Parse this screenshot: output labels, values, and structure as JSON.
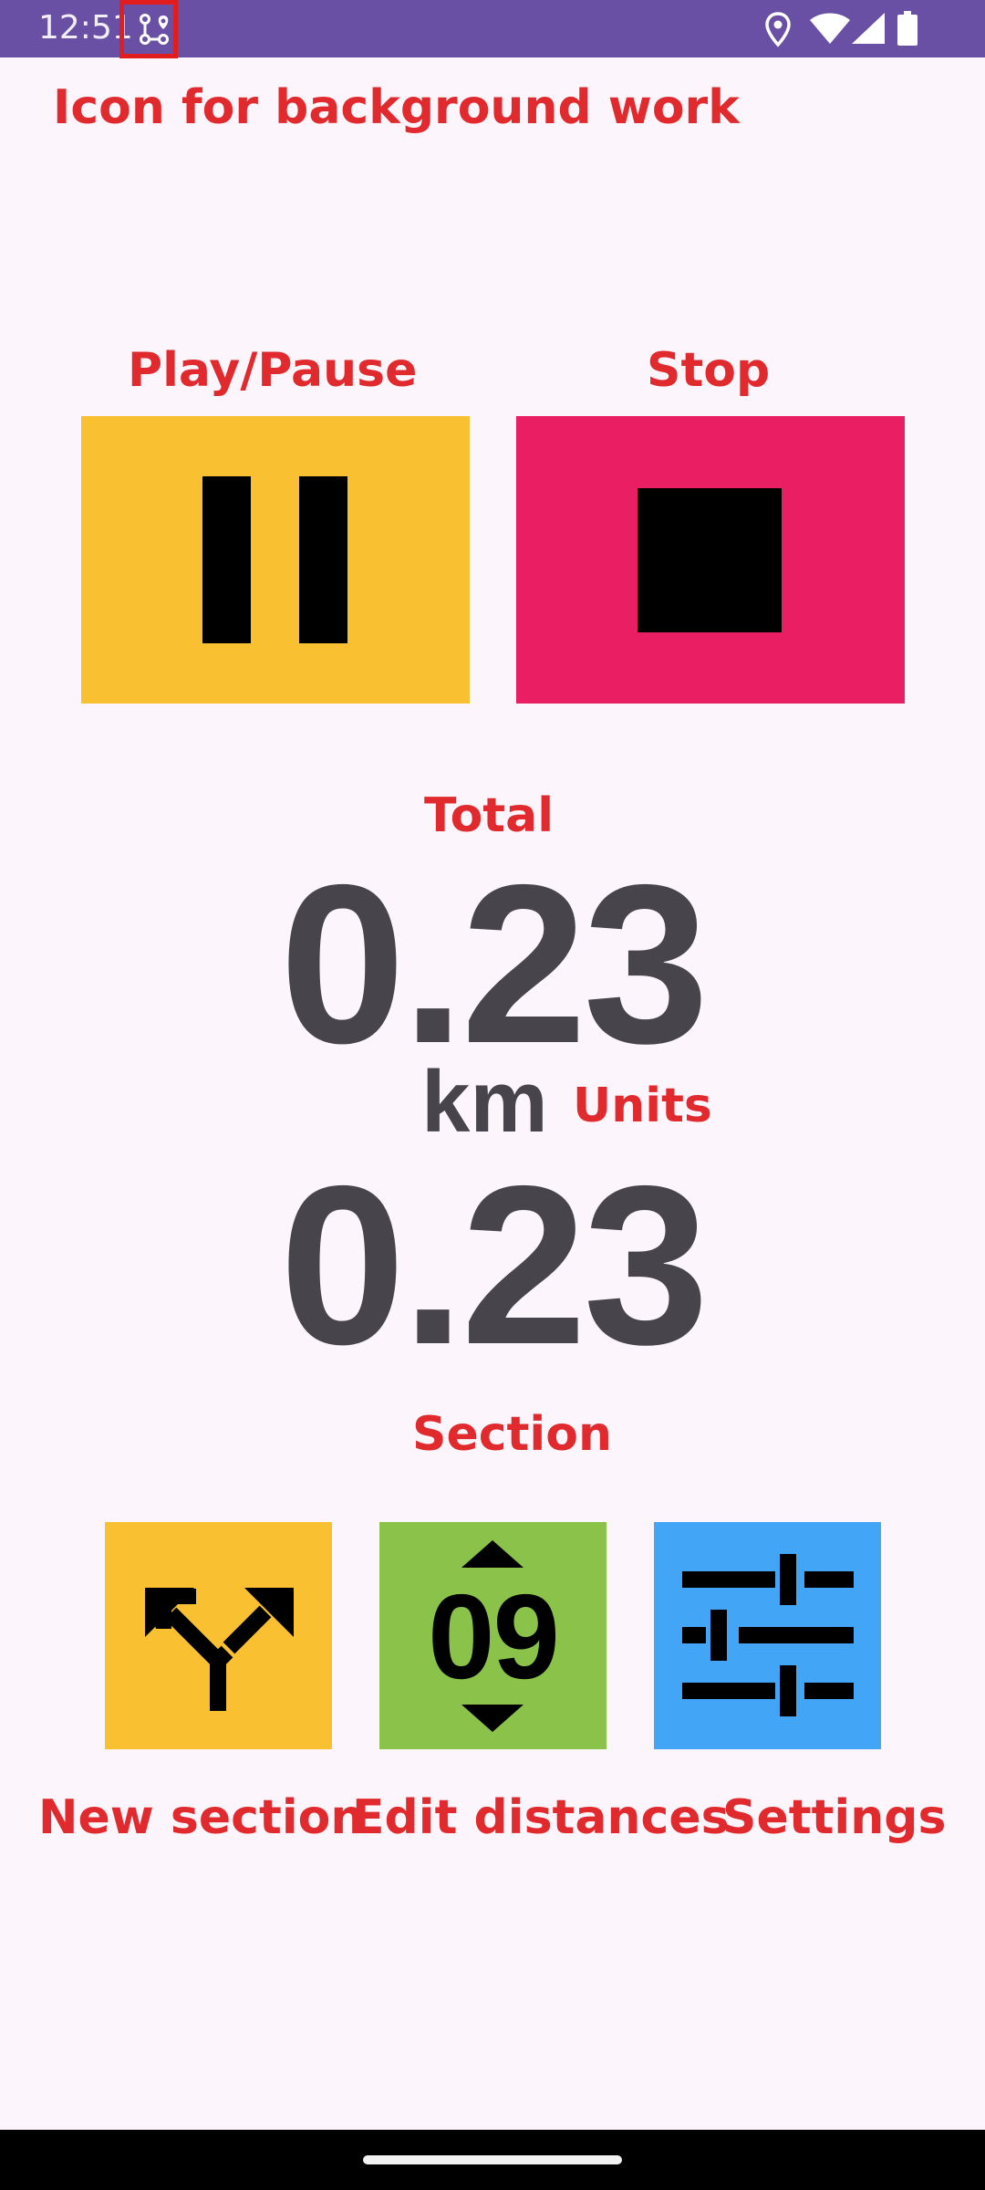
{
  "status_bar": {
    "time": "12:51",
    "background": "#6A50A4",
    "icons": [
      "background-work-icon",
      "location-icon",
      "wifi-icon",
      "signal-icon",
      "battery-icon"
    ]
  },
  "annotations": {
    "background_work": "Icon for background work",
    "play_pause": "Play/Pause",
    "stop": "Stop",
    "total": "Total",
    "units": "Units",
    "section": "Section",
    "new_section": "New section",
    "edit_distances": "Edit distances",
    "settings": "Settings",
    "color": "#E02A2E"
  },
  "controls": {
    "play_pause": {
      "icon": "pause-icon",
      "color": "#F9C032"
    },
    "stop": {
      "icon": "stop-icon",
      "color": "#E91E63"
    },
    "new_section": {
      "icon": "fork-arrow-icon",
      "color": "#F9C032"
    },
    "edit_distances": {
      "icon": "number-stepper-icon",
      "digits": "09",
      "color": "#8BC34A"
    },
    "settings": {
      "icon": "sliders-icon",
      "color": "#42A5F5"
    }
  },
  "readout": {
    "total_distance": "0.23",
    "units": "km",
    "section_distance": "0.23",
    "color": "#47444C"
  }
}
